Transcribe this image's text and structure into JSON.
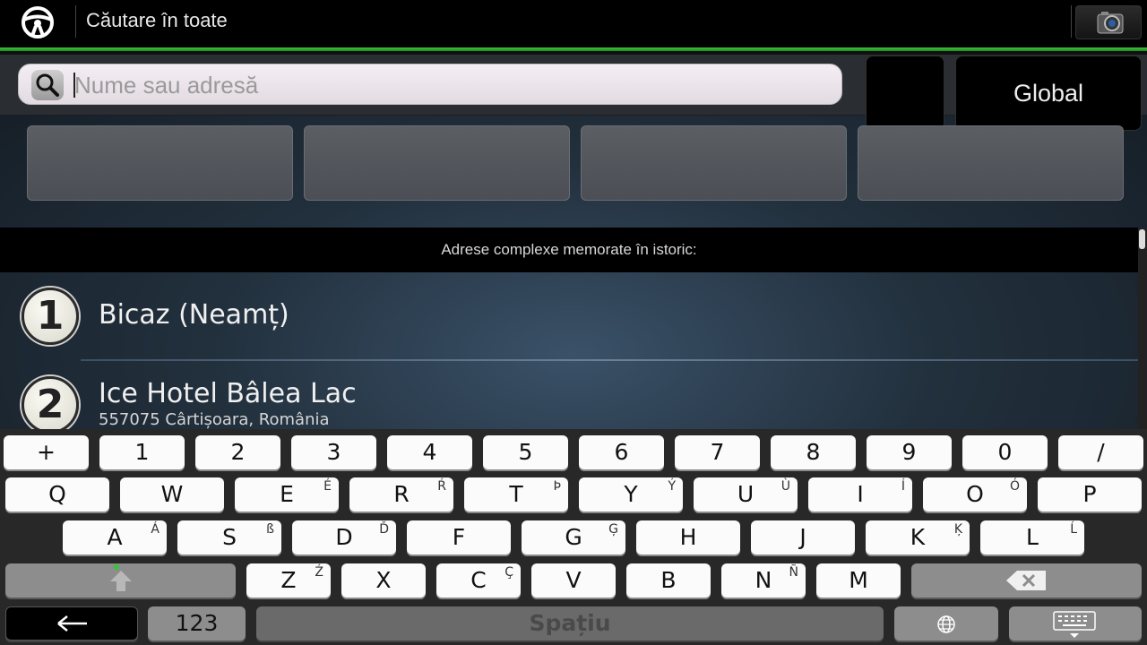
{
  "header": {
    "title": "Căutare în toate",
    "steering_icon": "steering-wheel-icon",
    "camera_icon": "camera-icon"
  },
  "search": {
    "placeholder": "Nume sau adresă",
    "value": "",
    "scope_label": "Global",
    "icon": "search-icon"
  },
  "history": {
    "header": "Adrese complexe memorate în istoric:",
    "items": [
      {
        "number": "1",
        "title": "Bicaz (Neamț)",
        "subtitle": ""
      },
      {
        "number": "2",
        "title": "Ice Hotel Bâlea Lac",
        "subtitle": "557075 Cârtișoara, România"
      }
    ]
  },
  "keyboard": {
    "row1": [
      {
        "main": "+",
        "alt": ""
      },
      {
        "main": "1",
        "alt": ""
      },
      {
        "main": "2",
        "alt": ""
      },
      {
        "main": "3",
        "alt": ""
      },
      {
        "main": "4",
        "alt": ""
      },
      {
        "main": "5",
        "alt": ""
      },
      {
        "main": "6",
        "alt": ""
      },
      {
        "main": "7",
        "alt": ""
      },
      {
        "main": "8",
        "alt": ""
      },
      {
        "main": "9",
        "alt": ""
      },
      {
        "main": "0",
        "alt": ""
      },
      {
        "main": "/",
        "alt": ""
      }
    ],
    "row2": [
      {
        "main": "Q",
        "alt": ""
      },
      {
        "main": "W",
        "alt": ""
      },
      {
        "main": "E",
        "alt": "É"
      },
      {
        "main": "R",
        "alt": "Ŕ"
      },
      {
        "main": "T",
        "alt": "Þ"
      },
      {
        "main": "Y",
        "alt": "Ý"
      },
      {
        "main": "U",
        "alt": "Ù"
      },
      {
        "main": "I",
        "alt": "Í"
      },
      {
        "main": "O",
        "alt": "Ó"
      },
      {
        "main": "P",
        "alt": ""
      }
    ],
    "row3": [
      {
        "main": "A",
        "alt": "Á"
      },
      {
        "main": "S",
        "alt": "ß"
      },
      {
        "main": "D",
        "alt": "Ď"
      },
      {
        "main": "F",
        "alt": ""
      },
      {
        "main": "G",
        "alt": "Ģ"
      },
      {
        "main": "H",
        "alt": ""
      },
      {
        "main": "J",
        "alt": ""
      },
      {
        "main": "K",
        "alt": "Ķ"
      },
      {
        "main": "L",
        "alt": "Ĺ"
      }
    ],
    "row4": [
      {
        "main": "Z",
        "alt": "Ź"
      },
      {
        "main": "X",
        "alt": ""
      },
      {
        "main": "C",
        "alt": "Ç"
      },
      {
        "main": "V",
        "alt": ""
      },
      {
        "main": "B",
        "alt": ""
      },
      {
        "main": "N",
        "alt": "Ñ"
      },
      {
        "main": "M",
        "alt": ""
      }
    ],
    "numbers_label": "123",
    "space_label": "Spațiu",
    "icons": {
      "shift": "shift-arrow-icon",
      "backspace": "backspace-icon",
      "back": "back-arrow-icon",
      "language": "globe-icon",
      "hide": "keyboard-hide-icon"
    },
    "colors": {
      "shift_indicator": "#38c43a",
      "accent_line": "#2fb531"
    }
  }
}
